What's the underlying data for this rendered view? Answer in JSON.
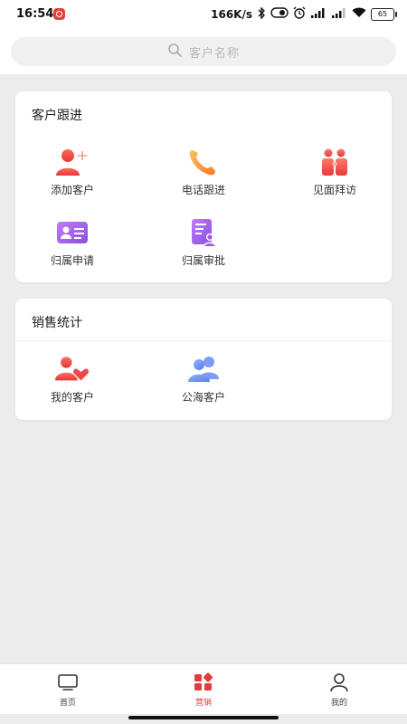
{
  "status_bar": {
    "time": "16:54",
    "network_speed": "166K/s",
    "battery": "65",
    "icons": [
      "bluetooth-icon",
      "nfc-icon",
      "alarm-icon",
      "signal-hd-icon",
      "signal-hd-icon",
      "wifi-icon",
      "battery-icon"
    ]
  },
  "search": {
    "placeholder": "客户名称",
    "icon": "search-icon"
  },
  "follow_up": {
    "title": "客户跟进",
    "items": [
      {
        "label": "添加客户",
        "icon": "add-customer-icon"
      },
      {
        "label": "电话跟进",
        "icon": "phone-icon"
      },
      {
        "label": "见面拜访",
        "icon": "visit-icon"
      },
      {
        "label": "归属申请",
        "icon": "id-card-icon"
      },
      {
        "label": "归属审批",
        "icon": "approval-doc-icon"
      }
    ]
  },
  "sales_stats": {
    "title": "销售统计",
    "items": [
      {
        "label": "我的客户",
        "icon": "my-customers-icon"
      },
      {
        "label": "公海客户",
        "icon": "public-customers-icon"
      }
    ]
  },
  "bottom_nav": {
    "items": [
      {
        "label": "首页",
        "icon": "tv-icon",
        "active": false
      },
      {
        "label": "营销",
        "icon": "apps-icon",
        "active": true
      },
      {
        "label": "我的",
        "icon": "user-icon",
        "active": false
      }
    ]
  },
  "colors": {
    "accent_red": "#e23d3d",
    "phone_orange": "#f39a3a",
    "purple": "#9b5de5",
    "blue": "#6b8df0"
  }
}
